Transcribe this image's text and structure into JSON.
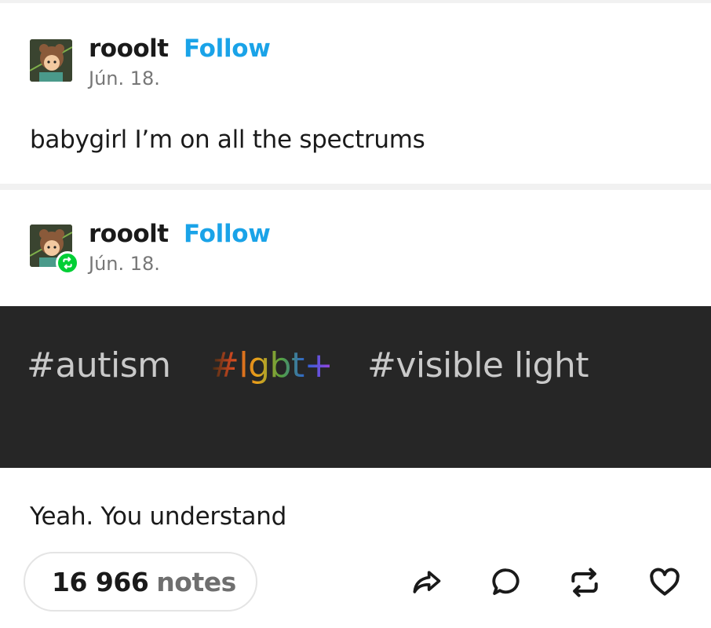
{
  "colors": {
    "follow": "#1aa3e8",
    "reblog_badge": "#00cf35",
    "tag_band": "#262626",
    "tag_text": "#c9c9c9"
  },
  "original_post": {
    "username": "rooolt",
    "follow_label": "Follow",
    "date": "Jún. 18.",
    "body": "babygirl I’m on all the spectrums"
  },
  "reblog_post": {
    "username": "rooolt",
    "follow_label": "Follow",
    "date": "Jún. 18.",
    "badge_icon": "reblog-icon",
    "tags": [
      "#autism",
      "#lgbt+",
      "#visible light"
    ],
    "body": "Yeah. You understand"
  },
  "footer": {
    "notes_count": "16 966",
    "notes_label": "notes",
    "actions": [
      "share-icon",
      "comment-icon",
      "reblog-icon",
      "like-icon"
    ]
  }
}
